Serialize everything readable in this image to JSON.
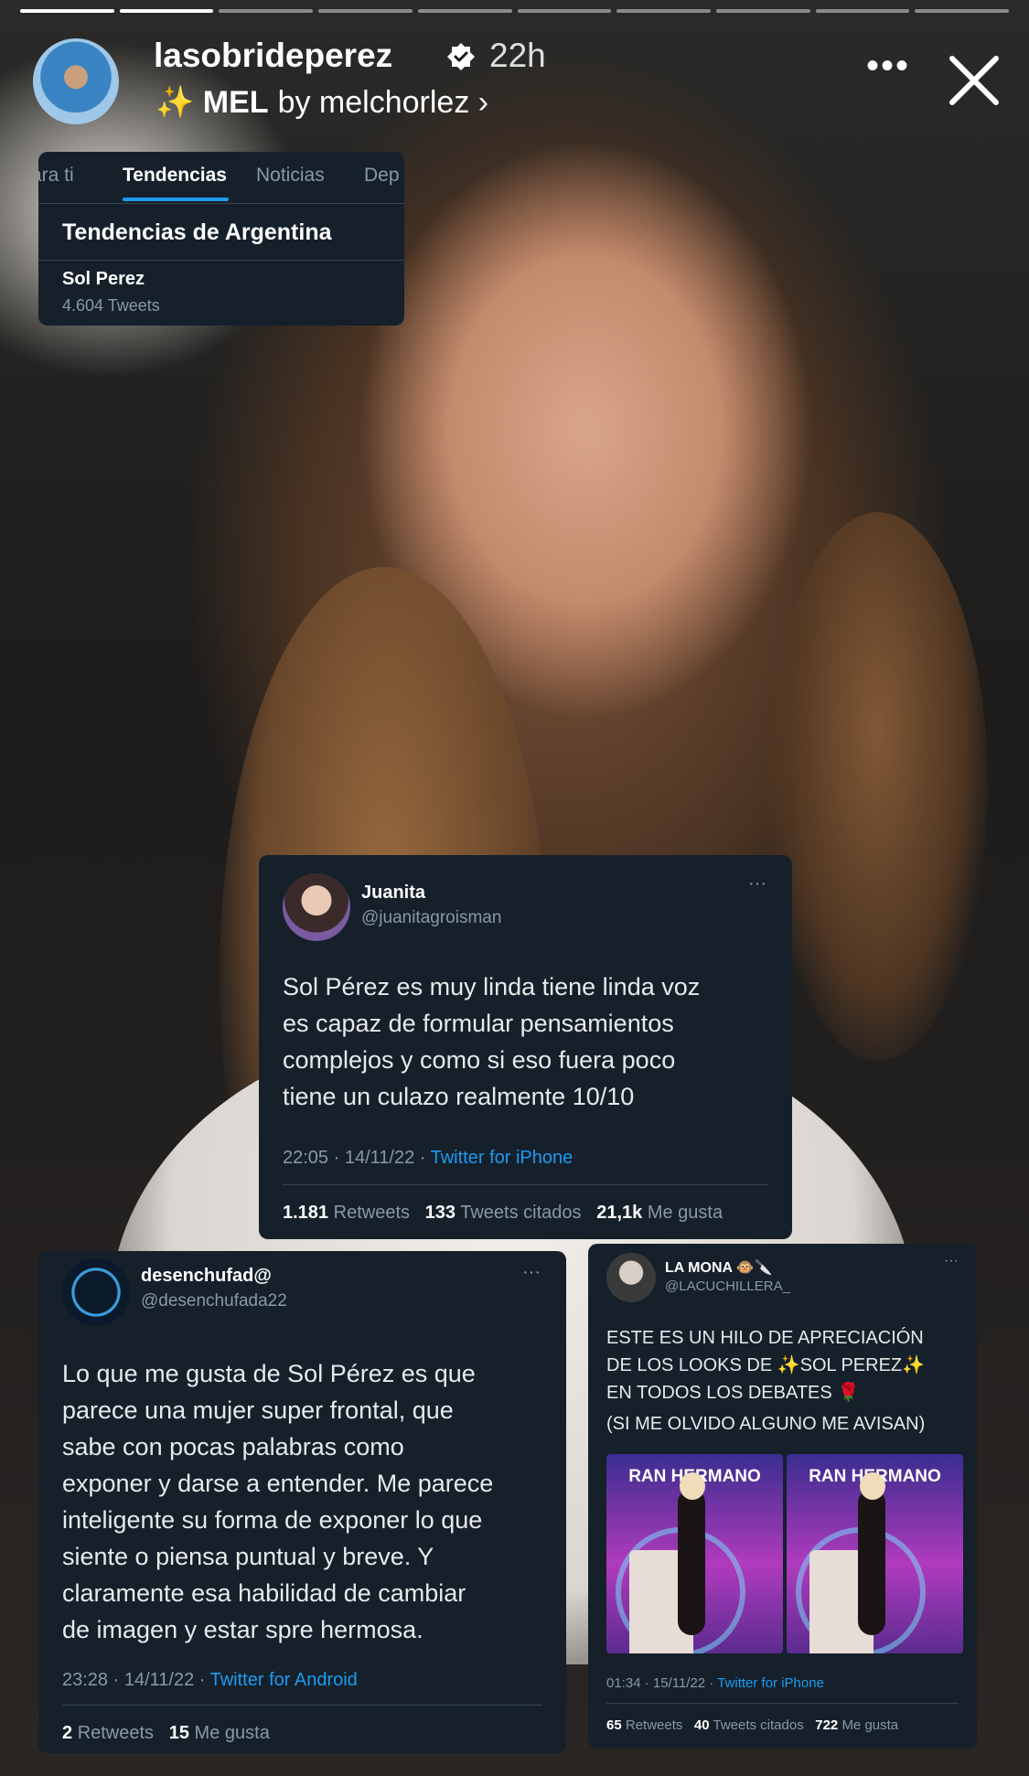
{
  "story": {
    "progress_total": 10,
    "progress_active_index": 1,
    "username": "lasobrideperez",
    "time": "22h",
    "music_icon": "sparkles-icon",
    "music_name": "MEL",
    "music_author": "by melchorlez",
    "more_label": "•••"
  },
  "trends": {
    "tabs": [
      "ara ti",
      "Tendencias",
      "Noticias",
      "Dep"
    ],
    "active_tab": "Tendencias",
    "heading": "Tendencias de Argentina",
    "item_name": "Sol Perez",
    "item_count": "4.604 Tweets"
  },
  "tweets": [
    {
      "name": "Juanita",
      "handle": "@juanitagroisman",
      "text": [
        "Sol Pérez es muy linda tiene linda voz",
        "es capaz de formular pensamientos",
        "complejos y como si eso fuera poco",
        "tiene un culazo realmente 10/10"
      ],
      "date": "22:05 · 14/11/22 · ",
      "source": "Twitter for iPhone",
      "stats": [
        {
          "value": "1.181",
          "label": "Retweets"
        },
        {
          "value": "133",
          "label": "Tweets citados"
        },
        {
          "value": "21,1k",
          "label": "Me gusta"
        }
      ]
    },
    {
      "name": "desenchufad@",
      "handle": "@desenchufada22",
      "text": [
        "Lo que me gusta de Sol Pérez es que",
        "parece una mujer super frontal, que",
        "sabe con pocas palabras como",
        "exponer y darse a entender. Me parece",
        "inteligente su forma de exponer lo que",
        "siente o piensa puntual y breve. Y",
        "claramente esa habilidad de cambiar",
        "de imagen y estar spre hermosa."
      ],
      "date": "23:28 · 14/11/22 · ",
      "source": "Twitter for Android",
      "stats": [
        {
          "value": "2",
          "label": "Retweets"
        },
        {
          "value": "15",
          "label": "Me gusta"
        }
      ]
    },
    {
      "name": "LA MONA 🐵🔪",
      "handle": "@LACUCHILLERA_",
      "text": [
        "ESTE ES UN HILO DE APRECIACIÓN",
        "DE LOS LOOKS DE ✨SOL PEREZ✨",
        "EN TODOS LOS DEBATES 🌹",
        "(SI ME OLVIDO ALGUNO ME AVISAN)"
      ],
      "image_banners": [
        "RAN HERMANO",
        "RAN HERMANO"
      ],
      "date": "01:34 · 15/11/22 · ",
      "source": "Twitter for iPhone",
      "stats": [
        {
          "value": "65",
          "label": "Retweets"
        },
        {
          "value": "40",
          "label": "Tweets citados"
        },
        {
          "value": "722",
          "label": "Me gusta"
        }
      ]
    }
  ],
  "colors": {
    "tweet_bg": "#15202b",
    "link": "#1d9bf0",
    "muted": "#8b98a5"
  }
}
